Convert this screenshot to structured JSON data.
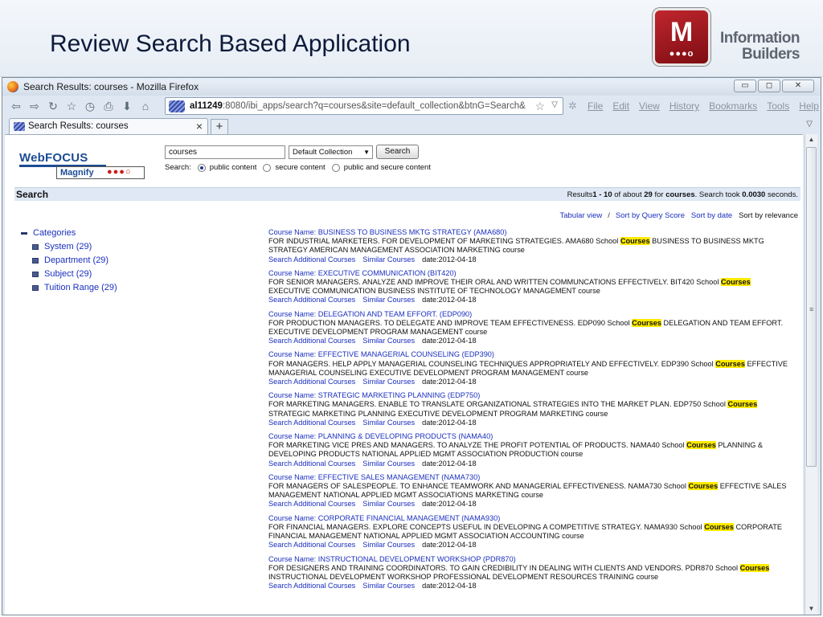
{
  "slide": {
    "title": "Review Search Based Application",
    "logo_letter": "M",
    "logo_dots": "●●●o",
    "logo_text_line1": "Information",
    "logo_text_line2": "Builders"
  },
  "browser": {
    "window_title": "Search Results: courses - Mozilla Firefox",
    "controls": [
      "▭",
      "◻",
      "✕"
    ],
    "url_host": "al11249",
    "url_rest": ":8080/ibi_apps/search?q=courses&site=default_collection&btnG=Search&",
    "menu": [
      "File",
      "Edit",
      "View",
      "History",
      "Bookmarks",
      "Tools",
      "Help"
    ],
    "tab_label": "Search Results: courses",
    "tab_close": "×",
    "new_tab": "+"
  },
  "page": {
    "logo_brand": "WebFOCUS",
    "logo_product": "Magnify",
    "logo_dots": "●●●○",
    "search_value": "courses",
    "collection": "Default Collection",
    "search_button": "Search",
    "scope_label": "Search:",
    "scope_options": [
      "public content",
      "secure content",
      "public and secure content"
    ],
    "band_title": "Search",
    "stats": {
      "prefix": "Results",
      "range": "1 - 10",
      "of": " of about ",
      "total": "29",
      "for": " for ",
      "query": "courses",
      "took": ". Search took ",
      "time": "0.0030",
      "unit": " seconds."
    },
    "sort": [
      "Tabular view",
      "/",
      "Sort by Query Score",
      "Sort by date",
      "Sort by relevance"
    ],
    "facets": {
      "root": "Categories",
      "items": [
        "System  (29)",
        "Department  (29)",
        "Subject  (29)",
        "Tuition Range  (29)"
      ]
    },
    "result_links": {
      "search_additional": "Search Additional Courses",
      "similar": "Similar Courses"
    },
    "highlight_word": "Courses",
    "results": [
      {
        "title": "Course Name: BUSINESS TO BUSINESS MKTG STRATEGY (AMA680)",
        "pre": "FOR INDUSTRIAL MARKETERS. FOR DEVELOPMENT OF MARKETING STRATEGIES. AMA680 School ",
        "post": " BUSINESS TO BUSINESS MKTG STRATEGY AMERICAN MANAGEMENT ASSOCIATION MARKETING course",
        "date": "date:2012-04-18"
      },
      {
        "title": "Course Name: EXECUTIVE COMMUNICATION (BIT420)",
        "pre": "FOR SENIOR MANAGERS. ANALYZE AND IMPROVE THEIR ORAL AND WRITTEN COMMUNCATIONS EFFECTIVELY. BIT420 School ",
        "post": " EXECUTIVE COMMUNICATION BUSINESS INSTITUTE OF TECHNOLOGY MANAGEMENT course",
        "date": "date:2012-04-18"
      },
      {
        "title": "Course Name: DELEGATION AND TEAM EFFORT. (EDP090)",
        "pre": "FOR PRODUCTION MANAGERS. TO DELEGATE AND IMPROVE TEAM EFFECTIVENESS. EDP090 School ",
        "post": " DELEGATION AND TEAM EFFORT. EXECUTIVE DEVELOPMENT PROGRAM MANAGEMENT course",
        "date": "date:2012-04-18"
      },
      {
        "title": "Course Name: EFFECTIVE MANAGERIAL COUNSELING (EDP390)",
        "pre": "FOR MANAGERS. HELP APPLY MANAGERIAL COUNSELING TECHNIQUES APPROPRIATELY AND EFFECTIVELY. EDP390 School ",
        "post": " EFFECTIVE MANAGERIAL COUNSELING EXECUTIVE DEVELOPMENT PROGRAM MANAGEMENT course",
        "date": "date:2012-04-18"
      },
      {
        "title": "Course Name: STRATEGIC MARKETING PLANNING (EDP750)",
        "pre": "FOR MARKETING MANAGERS. ENABLE TO TRANSLATE ORGANIZATIONAL STRATEGIES INTO THE MARKET PLAN. EDP750 School ",
        "post": " STRATEGIC MARKETING PLANNING EXECUTIVE DEVELOPMENT PROGRAM MARKETING course",
        "date": "date:2012-04-18"
      },
      {
        "title": "Course Name: PLANNING & DEVELOPING PRODUCTS (NAMA40)",
        "pre": "FOR MARKETING VICE PRES AND MANAGERS. TO ANALYZE THE PROFIT POTENTIAL OF PRODUCTS. NAMA40 School ",
        "post": " PLANNING & DEVELOPING PRODUCTS NATIONAL APPLIED MGMT ASSOCIATION PRODUCTION course",
        "date": "date:2012-04-18"
      },
      {
        "title": "Course Name: EFFECTIVE SALES MANAGEMENT (NAMA730)",
        "pre": "FOR MANAGERS OF SALESPEOPLE. TO ENHANCE TEAMWORK AND MANAGERIAL EFFECTIVENESS. NAMA730 School ",
        "post": " EFFECTIVE SALES MANAGEMENT NATIONAL APPLIED MGMT ASSOCIATIONS MARKETING course",
        "date": "date:2012-04-18"
      },
      {
        "title": "Course Name: CORPORATE FINANCIAL MANAGEMENT (NAMA930)",
        "pre": "FOR FINANCIAL MANAGERS. EXPLORE CONCEPTS USEFUL IN DEVELOPING A COMPETITIVE STRATEGY. NAMA930 School ",
        "post": " CORPORATE FINANCIAL MANAGEMENT NATIONAL APPLIED MGMT ASSOCIATION ACCOUNTING course",
        "date": "date:2012-04-18"
      },
      {
        "title": "Course Name: INSTRUCTIONAL DEVELOPMENT WORKSHOP (PDR870)",
        "pre": "FOR DESIGNERS AND TRAINING COORDINATORS. TO GAIN CREDIBILITY IN DEALING WITH CLIENTS AND VENDORS. PDR870 School ",
        "post": " INSTRUCTIONAL DEVELOPMENT WORKSHOP PROFESSIONAL DEVELOPMENT RESOURCES TRAINING course",
        "date": "date:2012-04-18"
      }
    ]
  }
}
